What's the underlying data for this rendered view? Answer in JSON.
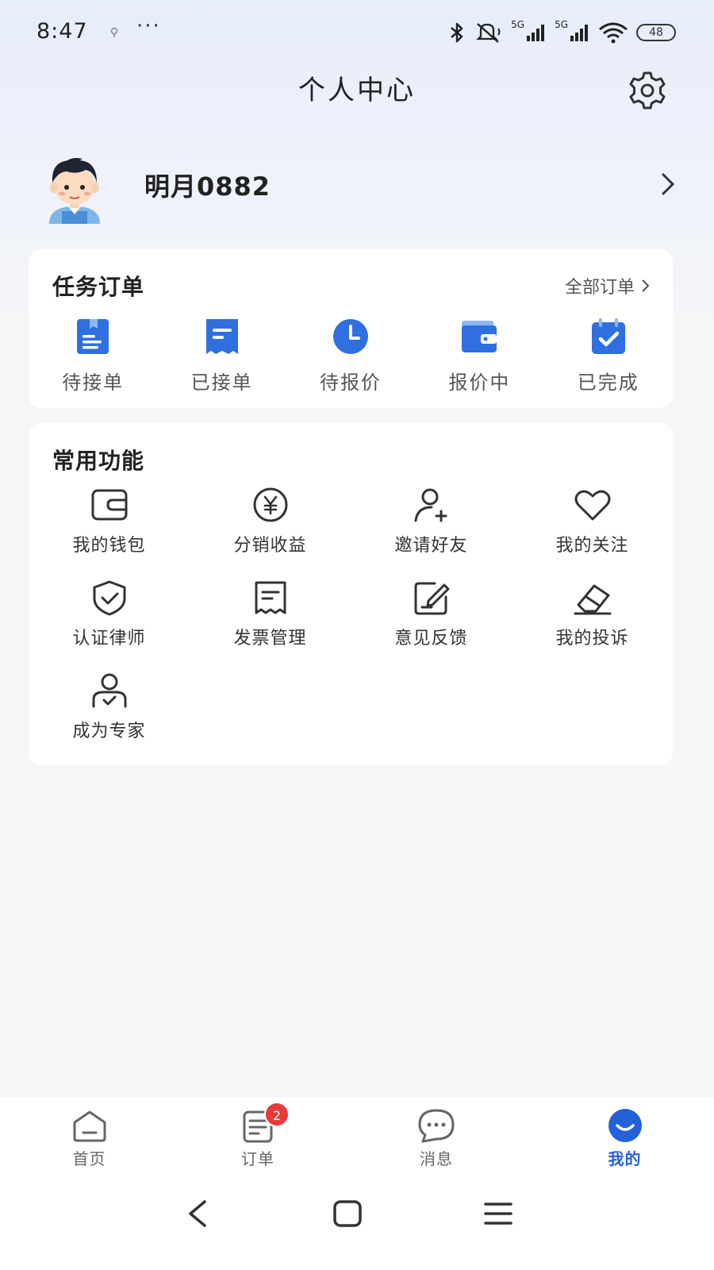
{
  "status_bar": {
    "time": "8:47",
    "more": "···",
    "signal1_label": "5G",
    "signal2_label": "5G",
    "battery": "48"
  },
  "header": {
    "title": "个人中心",
    "settings_icon": "gear-icon"
  },
  "profile": {
    "username": "明月0882",
    "arrow_icon": "chevron-right-icon"
  },
  "orders": {
    "title": "任务订单",
    "all_link": "全部订单",
    "items": [
      {
        "label": "待接单",
        "icon": "pending-accept-icon"
      },
      {
        "label": "已接单",
        "icon": "accepted-receipt-icon"
      },
      {
        "label": "待报价",
        "icon": "clock-icon"
      },
      {
        "label": "报价中",
        "icon": "wallet-icon"
      },
      {
        "label": "已完成",
        "icon": "calendar-check-icon"
      }
    ]
  },
  "functions": {
    "title": "常用功能",
    "items": [
      {
        "label": "我的钱包",
        "icon": "wallet-icon"
      },
      {
        "label": "分销收益",
        "icon": "yuan-coin-icon"
      },
      {
        "label": "邀请好友",
        "icon": "add-user-icon"
      },
      {
        "label": "我的关注",
        "icon": "heart-icon"
      },
      {
        "label": "认证律师",
        "icon": "shield-check-icon"
      },
      {
        "label": "发票管理",
        "icon": "invoice-icon"
      },
      {
        "label": "意见反馈",
        "icon": "feedback-edit-icon"
      },
      {
        "label": "我的投诉",
        "icon": "eraser-icon"
      },
      {
        "label": "成为专家",
        "icon": "expert-user-icon"
      }
    ]
  },
  "tabs": [
    {
      "label": "首页",
      "icon": "home-icon"
    },
    {
      "label": "订单",
      "icon": "order-list-icon",
      "badge": "2"
    },
    {
      "label": "消息",
      "icon": "message-icon"
    },
    {
      "label": "我的",
      "icon": "profile-smile-icon",
      "active": true
    }
  ],
  "nav": [
    "back-icon",
    "home-square-icon",
    "menu-icon"
  ],
  "colors": {
    "accent": "#2461d9",
    "badge": "#e83a3a",
    "background": "#f5f6f8"
  }
}
